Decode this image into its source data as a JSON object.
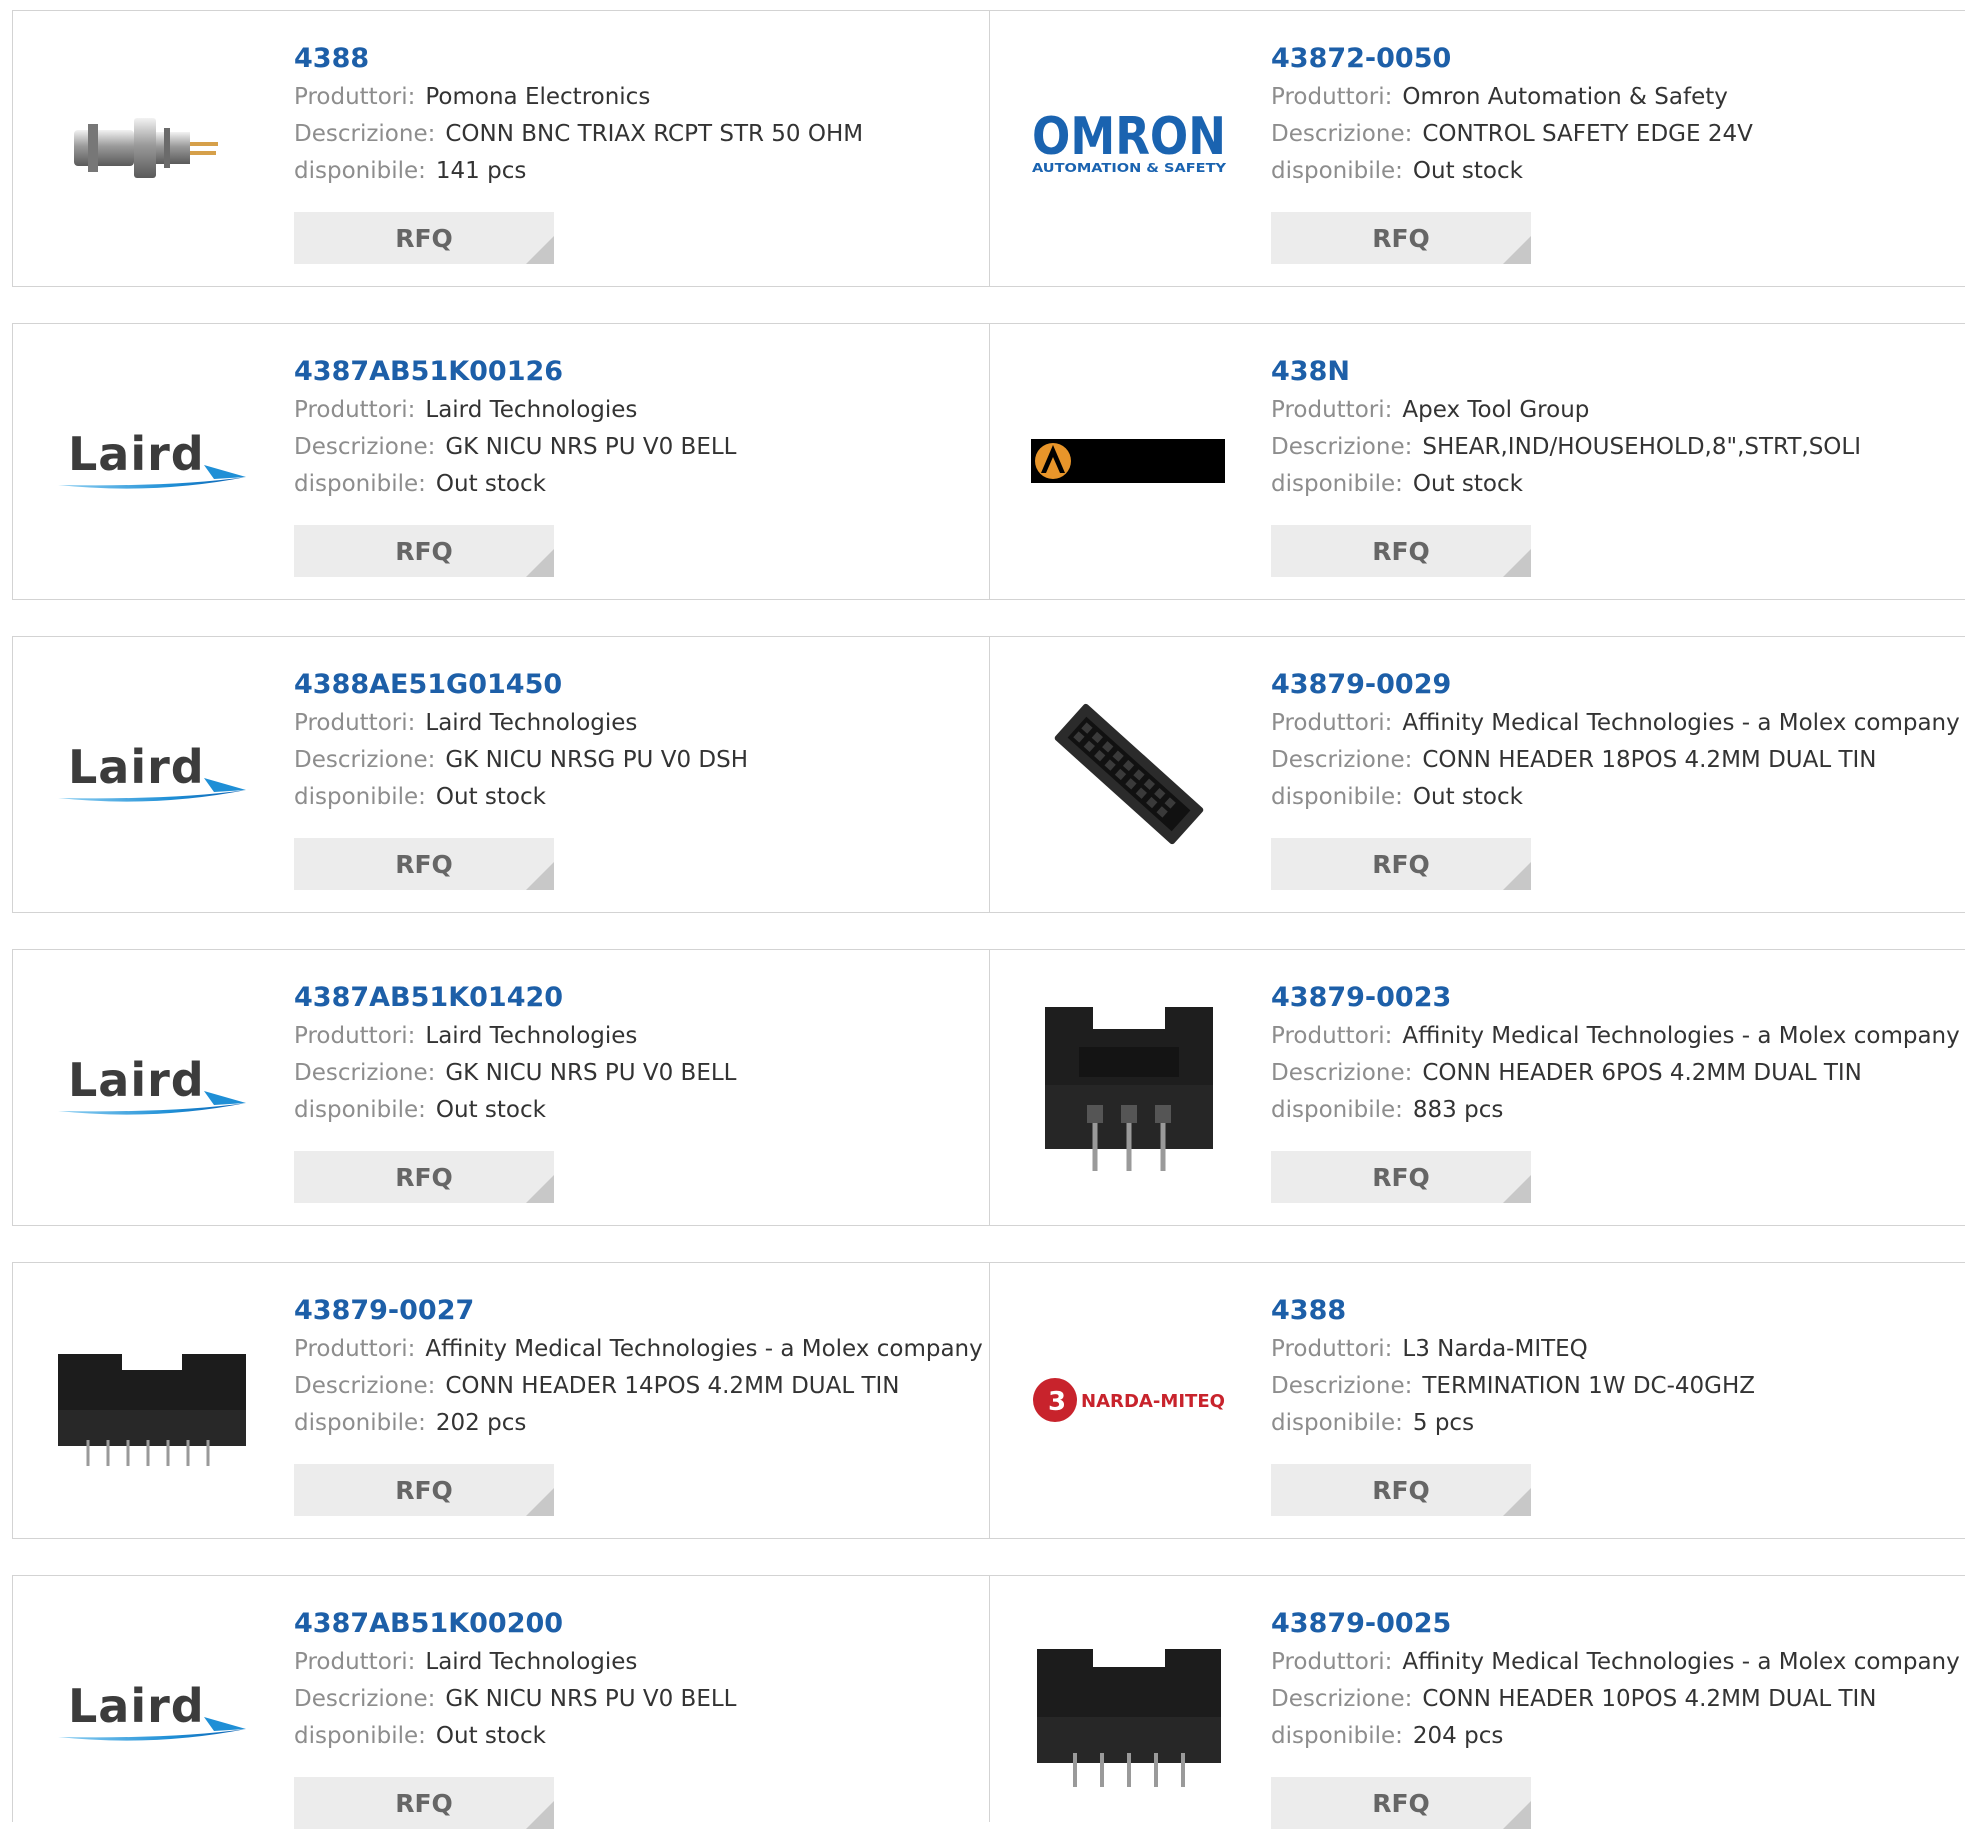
{
  "labels": {
    "manufacturer": "Produttori:",
    "description": "Descrizione:",
    "availability": "disponibile:",
    "rfq": "RFQ"
  },
  "colors": {
    "part_link": "#1d5fa8",
    "label": "#8d8d8d",
    "value": "#333333",
    "rfq_bg": "#ececec",
    "border": "#d3d3d3"
  },
  "products": [
    {
      "part": "4388",
      "manufacturer": "Pomona Electronics",
      "description": "CONN BNC TRIAX RCPT STR 50 OHM",
      "availability": "141 pcs",
      "image": "triax-connector-photo"
    },
    {
      "part": "43872-0050",
      "manufacturer": "Omron Automation & Safety",
      "description": "CONTROL SAFETY EDGE 24V",
      "availability": "Out stock",
      "image": "omron-logo",
      "logo_text": "OMRON",
      "logo_subtext": "AUTOMATION & SAFETY"
    },
    {
      "part": "4387AB51K00126",
      "manufacturer": "Laird Technologies",
      "description": "GK NICU NRS PU V0 BELL",
      "availability": "Out stock",
      "image": "laird-logo",
      "logo_text": "Laird"
    },
    {
      "part": "438N",
      "manufacturer": "Apex Tool Group",
      "description": "SHEAR,IND/HOUSEHOLD,8\",STRT,SOLI",
      "availability": "Out stock",
      "image": "apex-tool-group-logo"
    },
    {
      "part": "4388AE51G01450",
      "manufacturer": "Laird Technologies",
      "description": "GK NICU NRSG PU V0 DSH",
      "availability": "Out stock",
      "image": "laird-logo",
      "logo_text": "Laird"
    },
    {
      "part": "43879-0029",
      "manufacturer": "Affinity Medical Technologies - a Molex company",
      "description": "CONN HEADER 18POS 4.2MM DUAL TIN",
      "availability": "Out stock",
      "image": "angled-header-photo"
    },
    {
      "part": "4387AB51K01420",
      "manufacturer": "Laird Technologies",
      "description": "GK NICU NRS PU V0 BELL",
      "availability": "Out stock",
      "image": "laird-logo",
      "logo_text": "Laird"
    },
    {
      "part": "43879-0023",
      "manufacturer": "Affinity Medical Technologies - a Molex company",
      "description": "CONN HEADER 6POS 4.2MM DUAL TIN",
      "availability": "883 pcs",
      "image": "header-6pos-photo"
    },
    {
      "part": "43879-0027",
      "manufacturer": "Affinity Medical Technologies - a Molex company",
      "description": "CONN HEADER 14POS 4.2MM DUAL TIN",
      "availability": "202 pcs",
      "image": "header-14pos-photo"
    },
    {
      "part": "4388",
      "manufacturer": "L3 Narda-MITEQ",
      "description": "TERMINATION 1W DC-40GHZ",
      "availability": "5 pcs",
      "image": "l3-narda-miteq-logo",
      "logo_text": "NARDA-MITEQ",
      "logo_mark": "3"
    },
    {
      "part": "4387AB51K00200",
      "manufacturer": "Laird Technologies",
      "description": "GK NICU NRS PU V0 BELL",
      "availability": "Out stock",
      "image": "laird-logo",
      "logo_text": "Laird"
    },
    {
      "part": "43879-0025",
      "manufacturer": "Affinity Medical Technologies - a Molex company",
      "description": "CONN HEADER 10POS 4.2MM DUAL TIN",
      "availability": "204 pcs",
      "image": "header-10pos-photo"
    }
  ]
}
